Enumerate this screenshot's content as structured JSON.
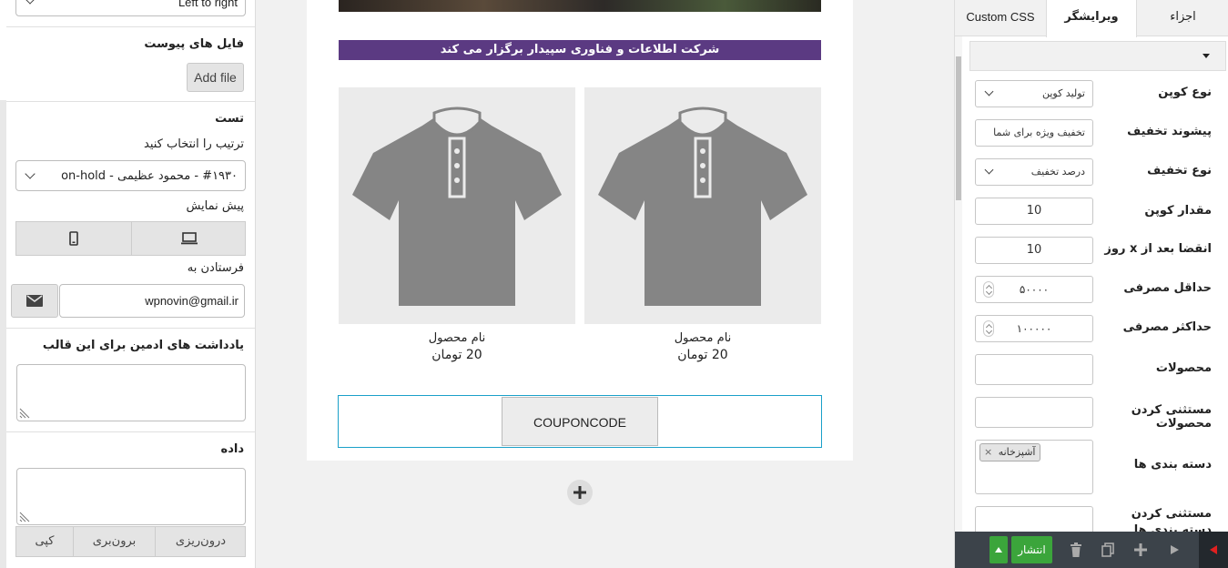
{
  "left": {
    "direction_value": "Left to right",
    "attachments": {
      "title": "فایل های پیوست",
      "add_file": "Add file"
    },
    "test": {
      "title": "تست",
      "order_label": "ترتیب را انتخاب کنید",
      "order_value": "#۱۹۳۰ - محمود عظیمی - on-hold"
    },
    "preview": {
      "title": "پیش نمایش"
    },
    "send_to": {
      "title": "فرستادن به",
      "email": "wpnovin@gmail.ir"
    },
    "admin_notes": {
      "title": "یادداشت های ادمین برای این قالب"
    },
    "data": {
      "title": "داده"
    },
    "tabs": [
      "کپی",
      "برون‌بری",
      "درون‌ریزی"
    ]
  },
  "canvas": {
    "banner": "شرکت اطلاعات و فناوری سپیدار برگزار می کند",
    "products": [
      {
        "name": "نام محصول",
        "price": "20 تومان"
      },
      {
        "name": "نام محصول",
        "price": "20 تومان"
      }
    ],
    "coupon_code": "COUPONCODE",
    "add_icon": "plus-icon"
  },
  "right": {
    "tabs": {
      "elements": "اجزاء",
      "editor": "ویرایشگر",
      "custom_css": "Custom CSS"
    },
    "fields": {
      "coupon_type": {
        "label": "نوع کوپن",
        "value": "تولید کوپن"
      },
      "discount_prefix": {
        "label": "پیشوند تخفیف",
        "value": "تخفیف ویژه برای شما"
      },
      "discount_type": {
        "label": "نوع تخفیف",
        "value": "درصد تخفیف"
      },
      "coupon_amount": {
        "label": "مقدار کوپن",
        "value": "10"
      },
      "expire_after": {
        "label": "انقضا بعد از x روز",
        "value": "10"
      },
      "min_spend": {
        "label": "حداقل مصرفی",
        "value": "۵۰۰۰۰"
      },
      "max_spend": {
        "label": "حداکثر مصرفی",
        "value": "۱۰۰۰۰۰"
      },
      "products": {
        "label": "محصولات",
        "value": ""
      },
      "exclude_products": {
        "label": "مستثنی کردن محصولات",
        "value": ""
      },
      "categories": {
        "label": "دسته بندی ها",
        "tag": "آشپزخانه"
      },
      "exclude_categories": {
        "label": "مستثنی کردن دسته بندی ها"
      }
    },
    "toolbar": {
      "publish": "انتشار"
    }
  },
  "colors": {
    "banner": "#5b3a82",
    "publish": "#3ba53b",
    "toolbar": "#3c434a",
    "selection": "#1aa0c9",
    "arrow_red": "#e02020"
  }
}
